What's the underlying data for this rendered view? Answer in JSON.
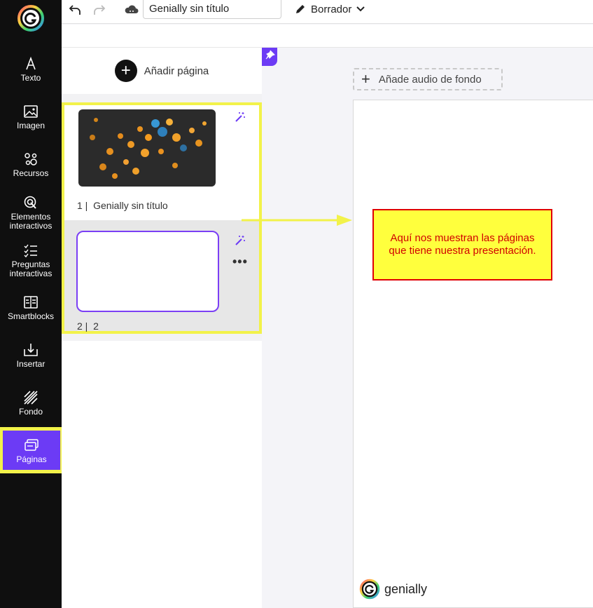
{
  "toolbar": {
    "undo_icon": "undo-icon",
    "redo_icon": "redo-icon",
    "cloud_icon": "cloud-icon",
    "title_value": "Genially sin título",
    "draft_label": "Borrador"
  },
  "sidebar": {
    "items": [
      {
        "label": "Texto",
        "icon": "text-icon"
      },
      {
        "label": "Imagen",
        "icon": "image-icon"
      },
      {
        "label": "Recursos",
        "icon": "resources-icon"
      },
      {
        "label": "Elementos interactivos",
        "icon": "interactive-elements-icon"
      },
      {
        "label": "Preguntas interactivas",
        "icon": "interactive-questions-icon"
      },
      {
        "label": "Smartblocks",
        "icon": "smartblocks-icon"
      },
      {
        "label": "Insertar",
        "icon": "insert-icon"
      },
      {
        "label": "Fondo",
        "icon": "background-icon"
      },
      {
        "label": "Páginas",
        "icon": "pages-icon"
      }
    ],
    "active_item": "Páginas",
    "accent_color": "#6c3bf5",
    "highlight_color": "#f2f24a"
  },
  "pages_panel": {
    "add_page_label": "Añadir página",
    "pages": [
      {
        "number": "1",
        "title": "Genially sin título"
      },
      {
        "number": "2",
        "title": "2"
      }
    ]
  },
  "canvas": {
    "audio_label": "Añade audio de fondo",
    "brand": "genially"
  },
  "annotation": {
    "text": "Aquí nos muestran las páginas que tiene nuestra presentación.",
    "line1": "Aquí nos muestran las páginas",
    "line2": "que tiene nuestra presentación."
  }
}
